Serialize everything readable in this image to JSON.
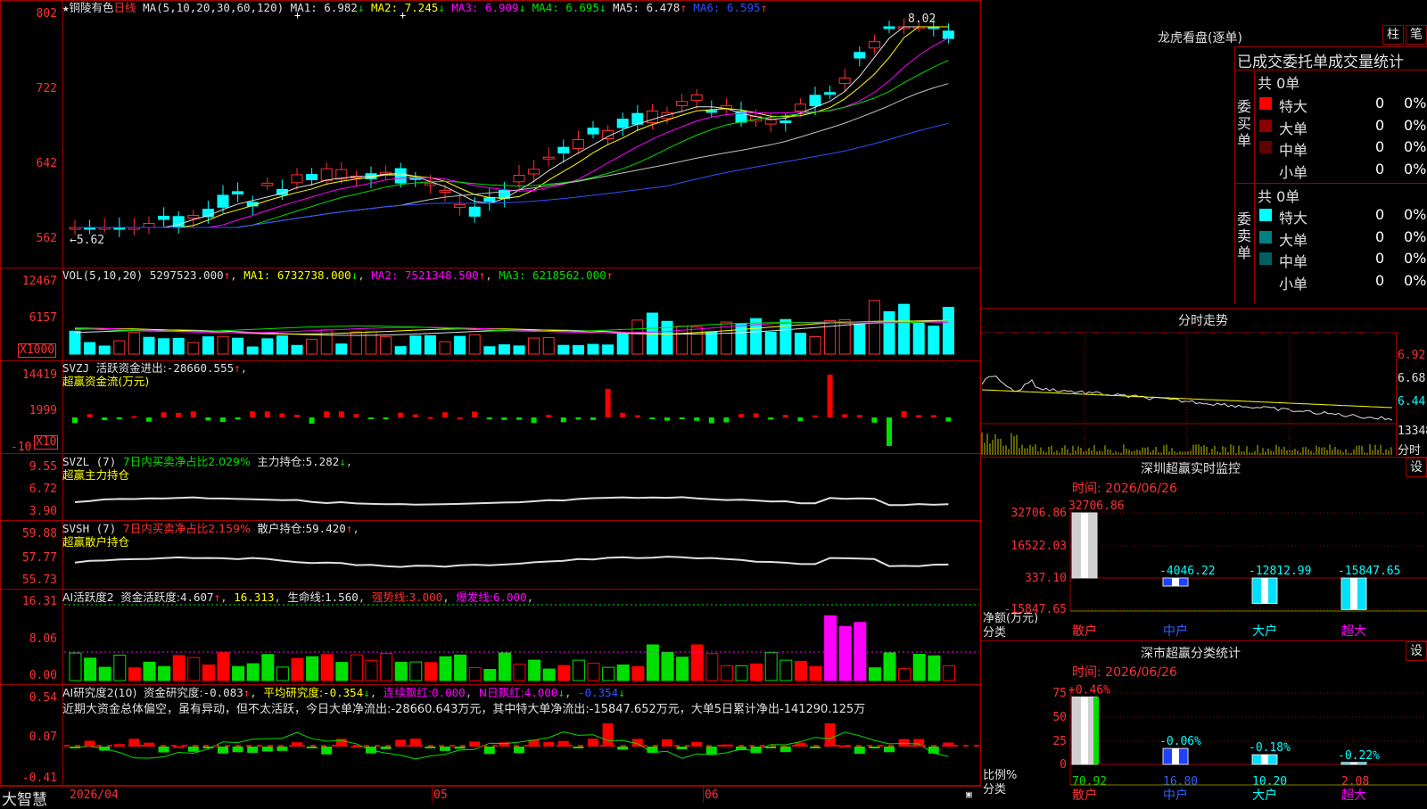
{
  "main": {
    "stock_name": "铜陵有色",
    "period": "日线",
    "ma_label": "MA(5,10,20,30,60,120)",
    "ma": [
      {
        "label": "MA1:",
        "value": "6.982",
        "arrow": "↓",
        "color": "#e0e0e0"
      },
      {
        "label": "MA2:",
        "value": "7.245",
        "arrow": "↓",
        "color": "#ffff00"
      },
      {
        "label": "MA3:",
        "value": "6.909",
        "arrow": "↓",
        "color": "#ff00ff"
      },
      {
        "label": "MA4:",
        "value": "6.695",
        "arrow": "↓",
        "color": "#00e000"
      },
      {
        "label": "MA5:",
        "value": "6.478",
        "arrow": "↑",
        "color": "#e0e0e0"
      },
      {
        "label": "MA6:",
        "value": "6.595",
        "arrow": "↑",
        "color": "#3050ff"
      }
    ],
    "y_ticks": [
      "802",
      "722",
      "642",
      "562"
    ],
    "high_marker": "8.02",
    "low_marker": "←5.62"
  },
  "vol": {
    "header": "VOL(5,10,20)",
    "value": "5297523.000",
    "ma1": "6732738.000",
    "ma2": "7521348.500",
    "ma3": "6218562.000",
    "y_ticks": [
      "12467",
      "6157"
    ],
    "unit": "X1000"
  },
  "svzj": {
    "name": "SVZJ",
    "label": "活跃资金进出:",
    "value": "-28660.555",
    "subtitle": "超赢资金流(万元)",
    "y_ticks": [
      "14419",
      "1999",
      "-10"
    ],
    "unit": "X10"
  },
  "svzl": {
    "name": "SVZL",
    "param": "(7)",
    "desc": "7日内买卖净占比2.029%",
    "label": "主力持仓:",
    "value": "5.282",
    "subtitle": "超赢主力持仓",
    "y_ticks": [
      "9.55",
      "6.72",
      "3.90"
    ]
  },
  "svsh": {
    "name": "SVSH",
    "param": "(7)",
    "desc": "7日内买卖净占比2.159%",
    "label": "散户持仓:",
    "value": "59.420",
    "subtitle": "超赢散户持仓",
    "y_ticks": [
      "59.88",
      "57.77",
      "55.73"
    ]
  },
  "ai_hyd": {
    "name": "AI活跃度2",
    "label": "资金活跃度:",
    "value": "4.607",
    "v2": "16.313",
    "life_label": "生命线:",
    "life": "1.560",
    "strong_label": "强势线:",
    "strong": "3.000",
    "burst_label": "爆发线:",
    "burst": "6.000",
    "y_ticks": [
      "16.31",
      "8.06",
      "0.00"
    ]
  },
  "ai_yjd": {
    "name": "AI研究度2(10)",
    "label": "资金研究度:",
    "value": "-0.083",
    "avg_label": "平均研究度:",
    "avg": "-0.354",
    "red_label": "连续飘红:",
    "red": "0.000",
    "n_label": "N日飘红:",
    "n": "4.000",
    "extra": "-0.354",
    "comment": "近期大资金总体偏空，虽有异动，但不太活跃，今日大单净流出:-28660.643万元，其中特大单净流出:-15847.652万元，大单5日累计净出-141290.125万",
    "y_ticks": [
      "0.54",
      "0.07",
      "-0.41"
    ]
  },
  "bottom": {
    "brand": "大智慧",
    "date": "2026/04",
    "months": [
      "05",
      "06"
    ]
  },
  "lhkp": {
    "title": "龙虎看盘(逐单)",
    "btn1": "柱",
    "btn2": "笔",
    "subtitle": "已成交委托单成交量统计",
    "buy_label": "委买单",
    "sell_label": "委卖单",
    "buy_total": "共 0单",
    "sell_total": "共 0单",
    "buy_rows": [
      {
        "name": "特大",
        "v1": "0",
        "v2": "0%",
        "color": "#ff0000"
      },
      {
        "name": "大单",
        "v1": "0",
        "v2": "0%",
        "color": "#8b0000"
      },
      {
        "name": "中单",
        "v1": "0",
        "v2": "0%",
        "color": "#600000"
      },
      {
        "name": "小单",
        "v1": "0",
        "v2": "0%",
        "color": "#000000"
      }
    ],
    "sell_rows": [
      {
        "name": "特大",
        "v1": "0",
        "v2": "0%",
        "color": "#00ffff"
      },
      {
        "name": "大单",
        "v1": "0",
        "v2": "0%",
        "color": "#008080"
      },
      {
        "name": "中单",
        "v1": "0",
        "v2": "0%",
        "color": "#006060"
      },
      {
        "name": "小单",
        "v1": "0",
        "v2": "0%",
        "color": "#000000"
      }
    ]
  },
  "fenshi": {
    "title": "分时走势",
    "y_ticks": [
      "6.92",
      "6.68",
      "6.44"
    ],
    "vol_tick": "13348",
    "unit": "分时"
  },
  "sz_monitor": {
    "title": "深圳超赢实时监控",
    "btn": "设",
    "time_label": "时间:",
    "time": "2026/06/26",
    "y_ticks": [
      "32706.86",
      "16522.03",
      "337.10",
      "-15847.65"
    ],
    "y_label1": "净额(万元)",
    "y_label2": "分类",
    "categories": [
      "散户",
      "中户",
      "大户",
      "超大"
    ],
    "values": [
      32706.86,
      -4046.22,
      -12812.99,
      -15847.65
    ],
    "value_labels": [
      "32706.86",
      "-4046.22",
      "-12812.99",
      "-15847.65"
    ]
  },
  "sz_class": {
    "title": "深市超赢分类统计",
    "btn": "设",
    "time_label": "时间:",
    "time": "2026/06/26",
    "y_ticks": [
      "75",
      "50",
      "25",
      "0"
    ],
    "y_label1": "比例%",
    "y_label2": "分类",
    "categories": [
      "散户",
      "中户",
      "大户",
      "超大"
    ],
    "values": [
      70.92,
      16.8,
      10.2,
      2.08
    ],
    "value_labels": [
      "70.92",
      "16.80",
      "10.20",
      "2.08"
    ],
    "change_labels": [
      "+0.46%",
      "-0.06%",
      "-0.18%",
      "-0.22%"
    ]
  }
}
